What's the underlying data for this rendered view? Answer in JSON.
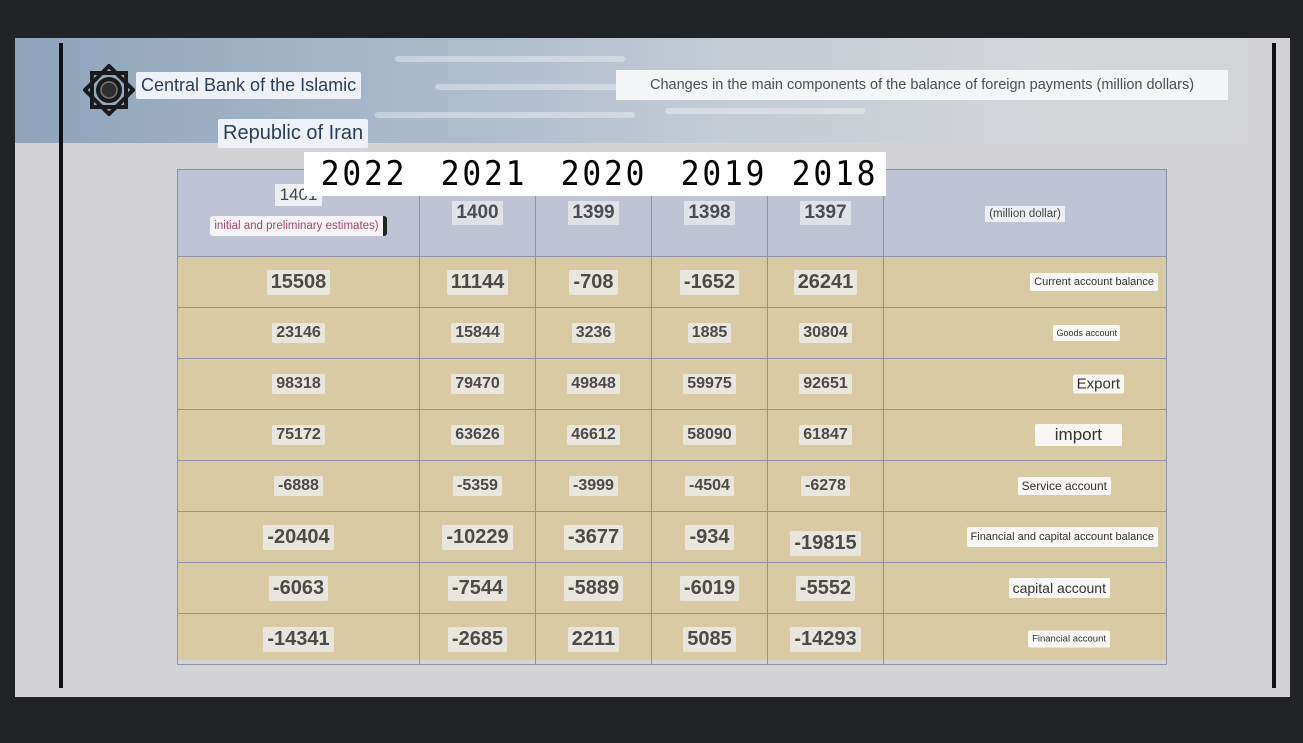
{
  "header": {
    "org_line1": "Central Bank of the Islamic",
    "org_line2": "Republic of Iran",
    "title": "Changes in the main components of the balance of foreign payments (million dollars)"
  },
  "overlay_years": [
    "2022",
    "2021",
    "2020",
    "2019",
    "2018"
  ],
  "table": {
    "columns": [
      "1401",
      "1400",
      "1399",
      "1398",
      "1397"
    ],
    "first_col_note": "initial and preliminary estimates)",
    "unit_label": "(million dollar)",
    "rows": [
      {
        "label": "Current account balance",
        "values": [
          "15508",
          "11144",
          "-708",
          "-1652",
          "26241"
        ]
      },
      {
        "label": "Goods account",
        "values": [
          "23146",
          "15844",
          "3236",
          "1885",
          "30804"
        ]
      },
      {
        "label": "Export",
        "values": [
          "98318",
          "79470",
          "49848",
          "59975",
          "92651"
        ]
      },
      {
        "label": "import",
        "values": [
          "75172",
          "63626",
          "46612",
          "58090",
          "61847"
        ]
      },
      {
        "label": "Service account",
        "values": [
          "-6888",
          "-5359",
          "-3999",
          "-4504",
          "-6278"
        ]
      },
      {
        "label": "Financial and capital account balance",
        "values": [
          "-20404",
          "-10229",
          "-3677",
          "-934",
          "-19815"
        ]
      },
      {
        "label": "capital account",
        "values": [
          "-6063",
          "-7544",
          "-5889",
          "-6019",
          "-5552"
        ]
      },
      {
        "label": "Financial account",
        "values": [
          "-14341",
          "-2685",
          "2211",
          "5085",
          "-14293"
        ]
      }
    ]
  },
  "colors": {
    "background": "#222327",
    "slide": "#d3d3d5",
    "table_body": "#d8cba4",
    "table_header": "#bfc3d3"
  }
}
